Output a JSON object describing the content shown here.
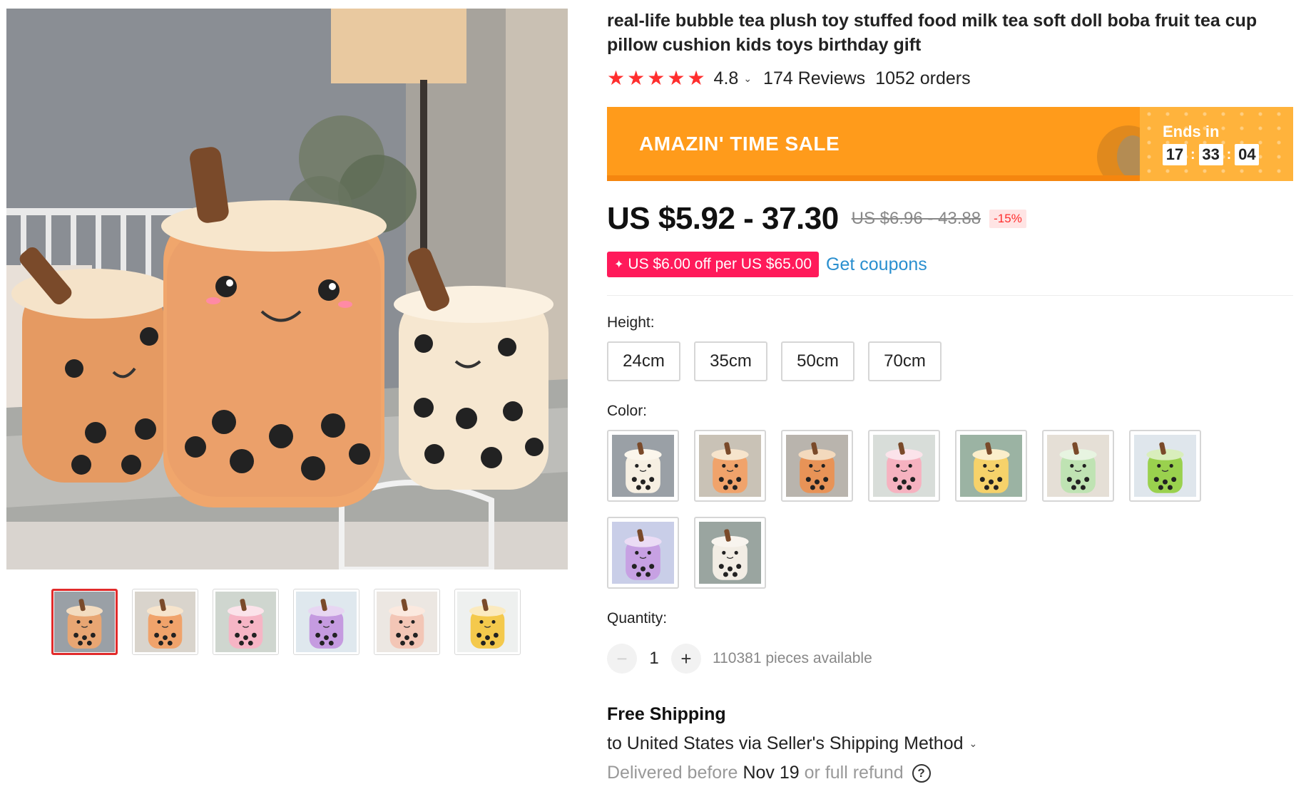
{
  "product": {
    "title": "real-life bubble tea plush toy stuffed food milk tea soft doll boba fruit tea cup pillow cushion kids toys birthday gift"
  },
  "gallery": {
    "main_image_alt": "bubble tea plush toys",
    "thumbnails": [
      {
        "name": "thumb-1",
        "cup": "#e8a673",
        "lid": "#f3dcc0",
        "bg": "#9aa0a6"
      },
      {
        "name": "thumb-2",
        "cup": "#f0a36b",
        "lid": "#f6e4cc",
        "bg": "#d9d4cc"
      },
      {
        "name": "thumb-3",
        "cup": "#f6b5c5",
        "lid": "#fbe3ea",
        "bg": "#cfd6cf"
      },
      {
        "name": "thumb-4",
        "cup": "#c59be0",
        "lid": "#e7d6f2",
        "bg": "#dfe8ee"
      },
      {
        "name": "thumb-5",
        "cup": "#f3c6b6",
        "lid": "#fbe9df",
        "bg": "#ece7e2"
      },
      {
        "name": "thumb-6",
        "cup": "#f4c94c",
        "lid": "#fbeabf",
        "bg": "#eef0ef"
      }
    ]
  },
  "rating": {
    "stars": 5,
    "value": "4.8",
    "reviews": "174 Reviews",
    "orders": "1052 orders"
  },
  "sale": {
    "title": "AMAZIN' TIME SALE",
    "ends_label": "Ends in",
    "hours": "17",
    "minutes": "33",
    "seconds": "04",
    "separator": ":"
  },
  "price": {
    "current": "US $5.92 - 37.30",
    "original": "US $6.96 - 43.88",
    "discount": "-15%"
  },
  "coupon": {
    "badge": "US $6.00 off per US $65.00",
    "link": "Get coupons"
  },
  "height": {
    "label": "Height:",
    "options": [
      "24cm",
      "35cm",
      "50cm",
      "70cm"
    ]
  },
  "color": {
    "label": "Color:",
    "swatches": [
      {
        "cup": "#f6efe2",
        "lid": "#fbf6ec",
        "bg": "#9aa0a6"
      },
      {
        "cup": "#f0a36b",
        "lid": "#f6e4cc",
        "bg": "#c9c2b6"
      },
      {
        "cup": "#e89357",
        "lid": "#f3d9bd",
        "bg": "#b9b4ad"
      },
      {
        "cup": "#f6b2c0",
        "lid": "#fbe3ea",
        "bg": "#d8ddd9"
      },
      {
        "cup": "#f6d26a",
        "lid": "#fbeecb",
        "bg": "#9bb3a3"
      },
      {
        "cup": "#bfe3b3",
        "lid": "#e7f4e1",
        "bg": "#e5dfd6"
      },
      {
        "cup": "#9ad14e",
        "lid": "#d9eebc",
        "bg": "#dfe6ec"
      },
      {
        "cup": "#c7a1e3",
        "lid": "#ebdcf5",
        "bg": "#c9cee8"
      },
      {
        "cup": "#f2ede4",
        "lid": "#f8f4ee",
        "bg": "#9aa5a0"
      }
    ]
  },
  "quantity": {
    "label": "Quantity:",
    "value": "1",
    "available": "110381 pieces available"
  },
  "shipping": {
    "title": "Free Shipping",
    "method": "to United States via Seller's Shipping Method",
    "delivered_prefix": "Delivered before",
    "delivery_date": "Nov 19",
    "delivered_suffix": "or full refund",
    "help_glyph": "?"
  },
  "colors": {
    "star": "#ff2e2e",
    "sale_orange": "#ff9b1b",
    "coupon_pink": "#ff1a5a",
    "link_blue": "#2a8fcf",
    "thumb_active_border": "#e12b2b"
  },
  "icons": {
    "star": "star-icon",
    "chevron": "chevron-down-icon",
    "minus": "minus-icon",
    "plus": "plus-icon",
    "help": "help-circle-icon"
  }
}
